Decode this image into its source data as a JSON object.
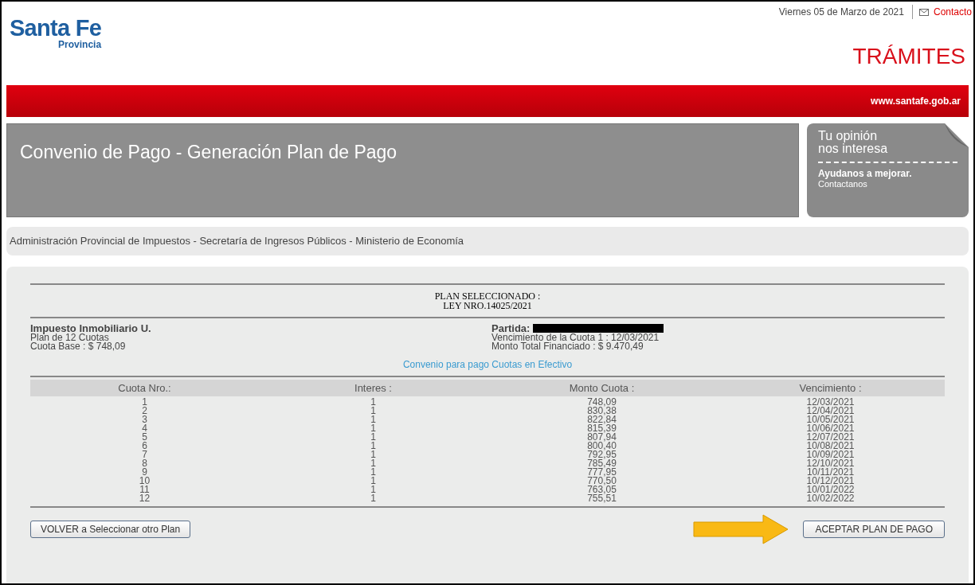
{
  "header": {
    "date": "Viernes 05 de Marzo de 2021",
    "contact_link": "Contacto",
    "logo_title": "Santa Fe",
    "logo_subtitle": "Provincia",
    "section": "TRÁMITES",
    "site_url": "www.santafe.gob.ar"
  },
  "title_banner": {
    "title": "Convenio de Pago - Generación Plan de Pago"
  },
  "feedback_card": {
    "line_1": "Tu opinión",
    "line_2": "nos interesa",
    "cta": "Ayudanos a mejorar.",
    "link": "Contactanos"
  },
  "breadcrumb": "Administración Provincial de Impuestos - Secretaría de Ingresos Públicos - Ministerio de Economía",
  "plan": {
    "heading": "PLAN SELECCIONADO :",
    "law": "LEY NRO.14025/2021",
    "left": {
      "tax": "Impuesto Inmobiliario U.",
      "installments": "Plan de 12 Cuotas",
      "base": "Cuota Base : $ 748,09"
    },
    "right": {
      "partida_label": "Partida:",
      "first_due": "Vencimiento de la Cuota 1 : 12/03/2021",
      "total": "Monto Total Financiado : $ 9.470,49"
    },
    "agreement": "Convenio para pago Cuotas en Efectivo"
  },
  "table": {
    "columns": [
      "Cuota Nro.:",
      "Interes :",
      "Monto Cuota :",
      "Vencimiento :"
    ],
    "rows": [
      [
        "1",
        "1",
        "748,09",
        "12/03/2021"
      ],
      [
        "2",
        "1",
        "830,38",
        "12/04/2021"
      ],
      [
        "3",
        "1",
        "822,84",
        "10/05/2021"
      ],
      [
        "4",
        "1",
        "815,39",
        "10/06/2021"
      ],
      [
        "5",
        "1",
        "807,94",
        "12/07/2021"
      ],
      [
        "6",
        "1",
        "800,40",
        "10/08/2021"
      ],
      [
        "7",
        "1",
        "792,95",
        "10/09/2021"
      ],
      [
        "8",
        "1",
        "785,49",
        "12/10/2021"
      ],
      [
        "9",
        "1",
        "777,95",
        "10/11/2021"
      ],
      [
        "10",
        "1",
        "770,50",
        "10/12/2021"
      ],
      [
        "11",
        "1",
        "763,05",
        "10/01/2022"
      ],
      [
        "12",
        "1",
        "755,51",
        "10/02/2022"
      ]
    ]
  },
  "buttons": {
    "back": "VOLVER a Seleccionar otro Plan",
    "accept": "ACEPTAR PLAN DE PAGO"
  }
}
